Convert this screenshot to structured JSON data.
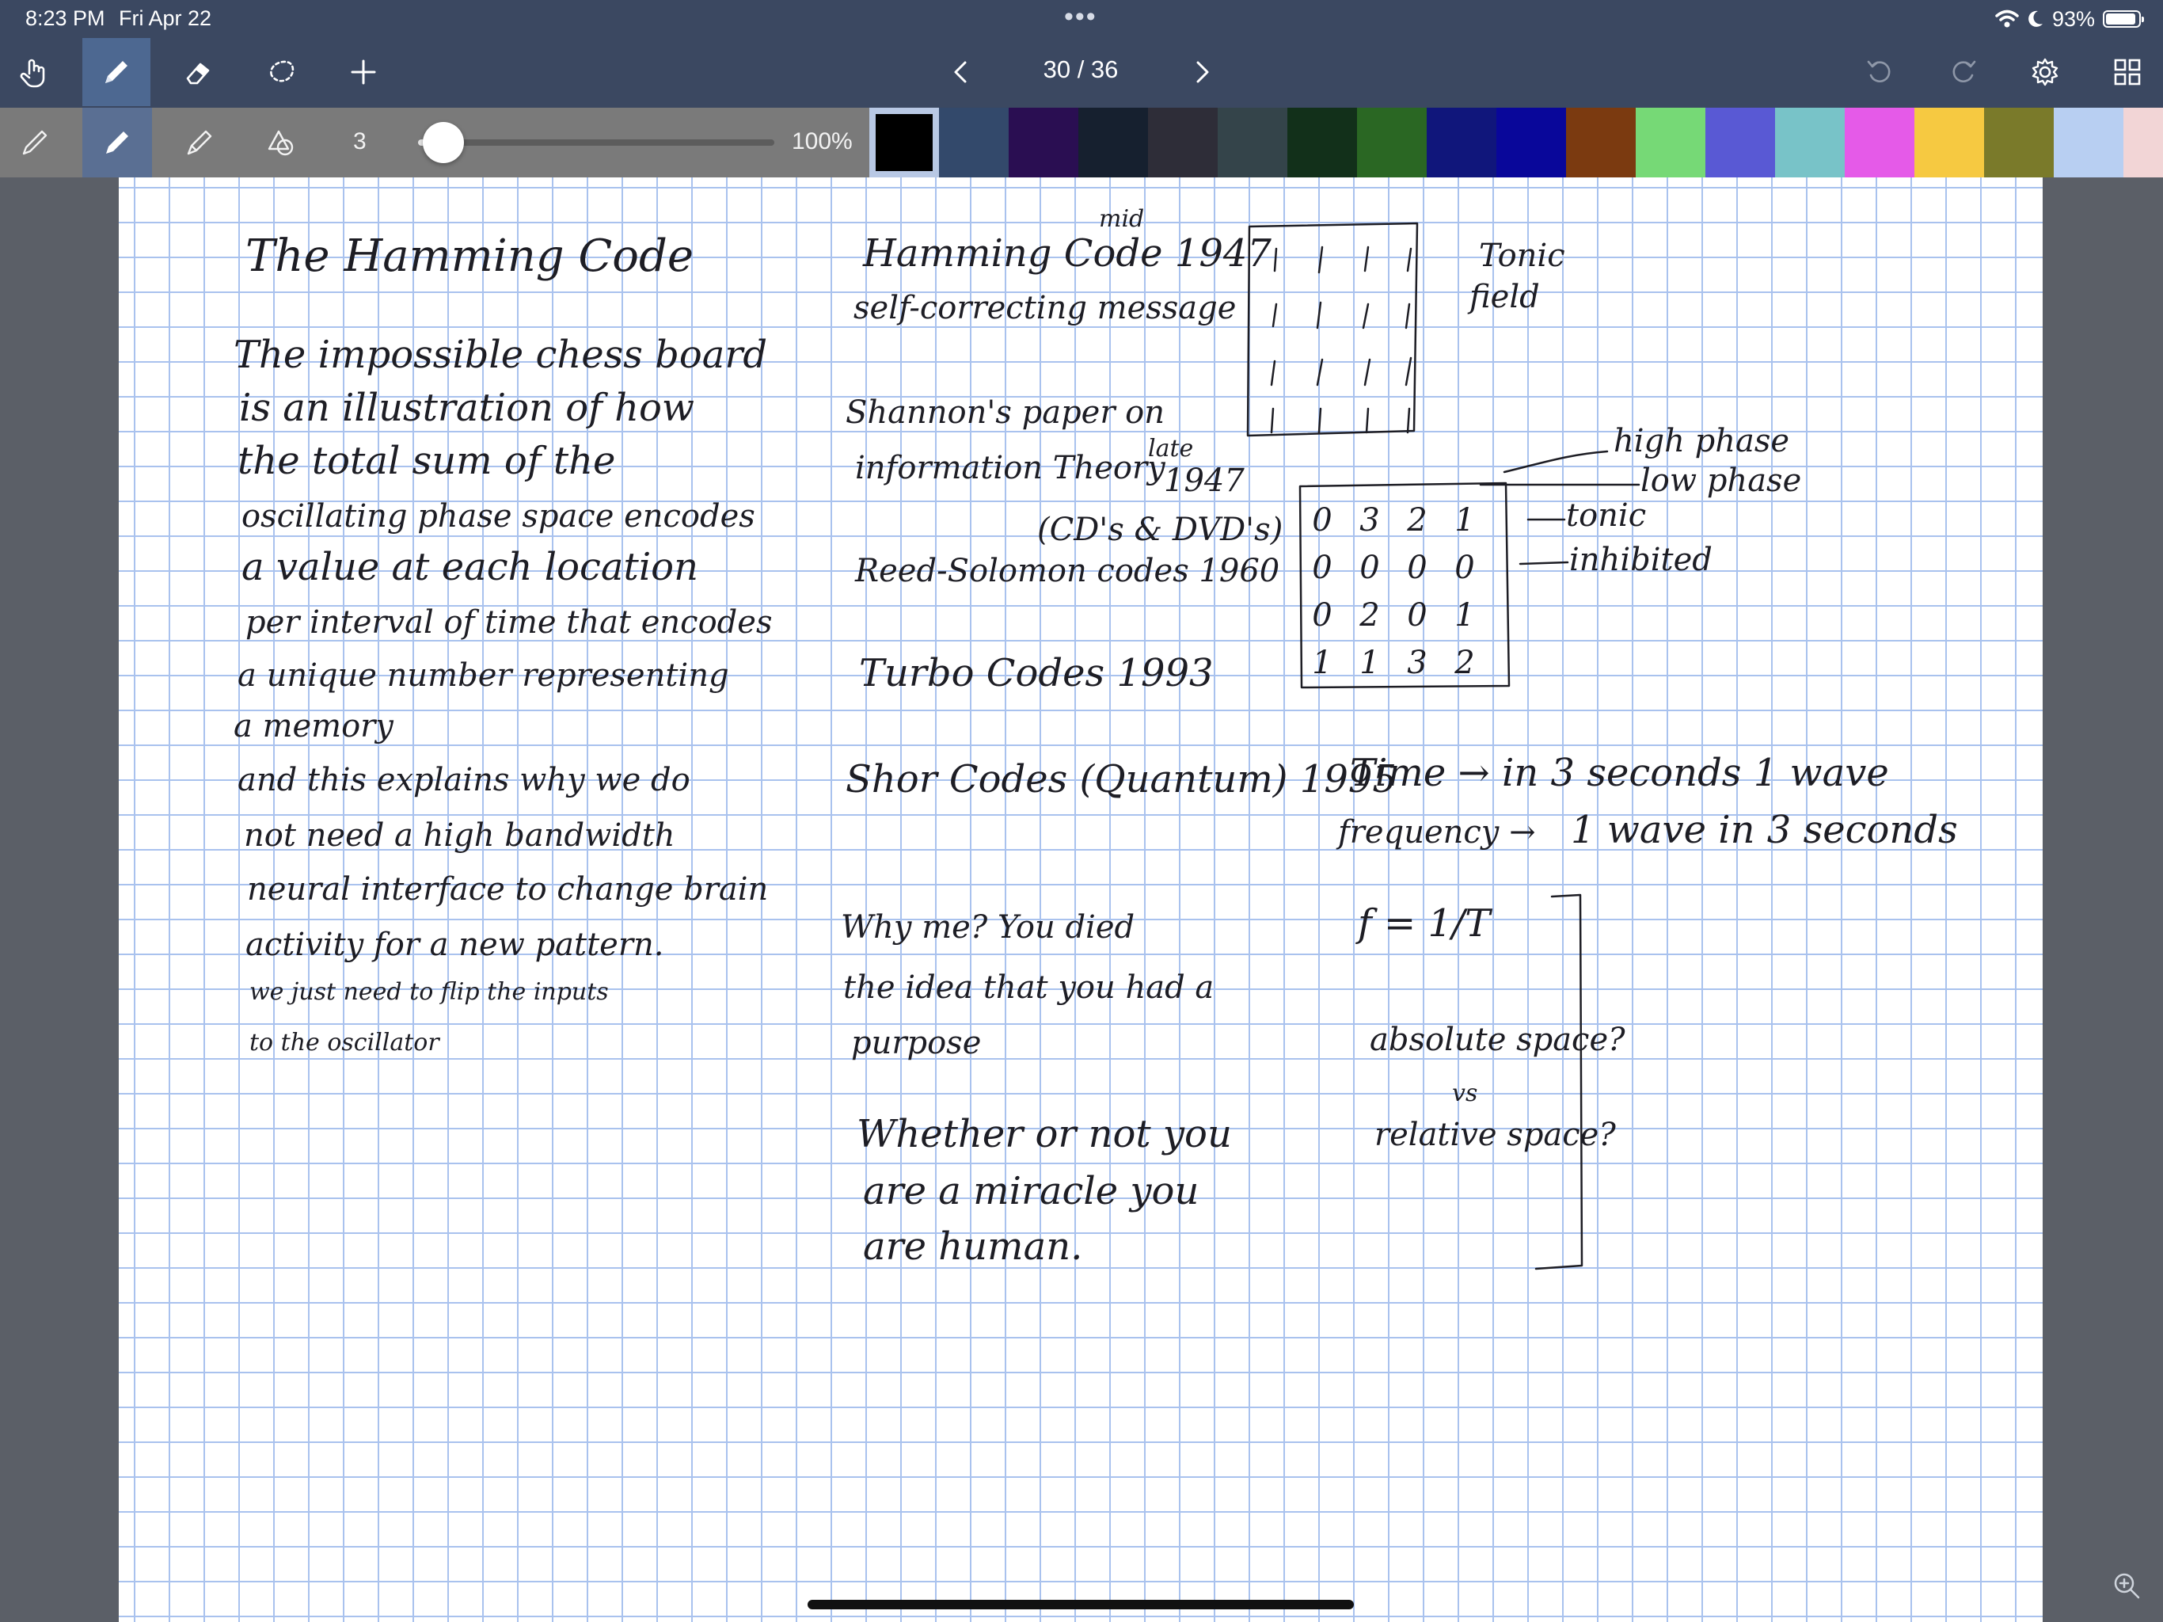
{
  "status": {
    "time": "8:23 PM",
    "date": "Fri Apr 22",
    "battery": "93%",
    "battery_level": 0.93
  },
  "toolbar": {
    "page": "30 / 36",
    "tools": [
      "hand-icon",
      "pen-icon",
      "eraser-icon",
      "lasso-icon",
      "add-icon",
      "undo-icon",
      "redo-icon",
      "gear-icon",
      "grid-icon"
    ],
    "active_tool": "pen"
  },
  "pen_options": {
    "size": "3",
    "opacity": "100%",
    "size_level": 0.07,
    "active_pen": "fountain-pen",
    "selected_color": "#000000",
    "colors": [
      "#000000",
      "#33496b",
      "#2a0e52",
      "#16202f",
      "#2e2d38",
      "#34444a",
      "#12301a",
      "#2a6723",
      "#10167b",
      "#09079a",
      "#7b3a10",
      "#76d976",
      "#5959d4",
      "#78c3c8",
      "#e55ae8",
      "#f6c941",
      "#7a7a2a",
      "#b8cff2",
      "#f2d5d6"
    ]
  },
  "note": {
    "col1": {
      "title": "The Hamming Code",
      "lines": [
        "The impossible chess board",
        "is an illustration of how",
        "the total sum of the",
        "oscillating phase space encodes",
        "a value at each location",
        "per interval of time that encodes",
        "a unique number representing",
        "a memory",
        "and this explains why we do",
        "not need a high bandwidth",
        "neural interface to change brain",
        "activity for a new pattern.",
        "we just need to flip the inputs",
        "to the oscillator"
      ]
    },
    "col2": {
      "hamming": "Hamming Code 1947",
      "mid": "mid",
      "self_correcting": "self-correcting message",
      "shannon1": "Shannon's paper on",
      "shannon2": "information Theory",
      "late": "late",
      "year1947": "1947",
      "cds": "(CD's & DVD's)",
      "reed": "Reed-Solomon codes 1960",
      "turbo": "Turbo Codes 1993",
      "shor": "Shor Codes (Quantum) 1995",
      "why1": "Why me? You died",
      "why2": "the idea that you had a",
      "why3": "purpose",
      "whether1": "Whether or not you",
      "whether2": "are a miracle you",
      "whether3": "are human."
    },
    "col3": {
      "tonic1": "Tonic",
      "tonic2": "field",
      "high_phase": "high phase",
      "low_phase": "low phase",
      "tonic": "tonic",
      "inhibited": "inhibited",
      "grid_rows": [
        [
          "0",
          "3",
          "2",
          "1"
        ],
        [
          "0",
          "0",
          "0",
          "0"
        ],
        [
          "0",
          "2",
          "0",
          "1"
        ],
        [
          "1",
          "1",
          "3",
          "2"
        ]
      ],
      "time1": "Time → in 3 seconds 1 wave",
      "freq1": "frequency →",
      "freq2": "1 wave in 3 seconds",
      "formula": "f = 1/T",
      "abs": "absolute space?",
      "vs": "vs",
      "rel": "relative space?"
    }
  }
}
